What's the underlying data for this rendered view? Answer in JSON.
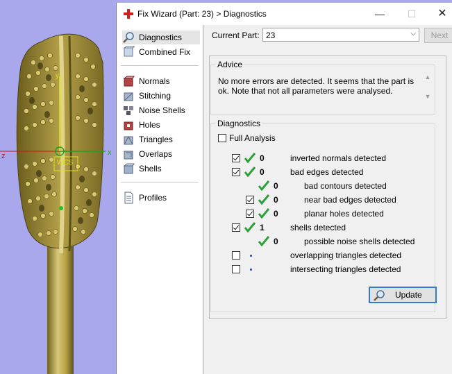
{
  "viewport": {
    "axis_x": "x",
    "axis_y": "y",
    "axis_z": "z",
    "label_box": "WCS"
  },
  "window": {
    "title": "Fix Wizard (Part: 23) > Diagnostics"
  },
  "nav": {
    "items": [
      {
        "label": "Diagnostics",
        "icon": "magnifier-icon"
      },
      {
        "label": "Combined Fix",
        "icon": "combined-fix-icon"
      },
      {
        "label": "Normals",
        "icon": "normals-icon"
      },
      {
        "label": "Stitching",
        "icon": "stitching-icon"
      },
      {
        "label": "Noise Shells",
        "icon": "noise-shells-icon"
      },
      {
        "label": "Holes",
        "icon": "holes-icon"
      },
      {
        "label": "Triangles",
        "icon": "triangles-icon"
      },
      {
        "label": "Overlaps",
        "icon": "overlaps-icon"
      },
      {
        "label": "Shells",
        "icon": "shells-icon"
      },
      {
        "label": "Profiles",
        "icon": "profiles-icon"
      }
    ]
  },
  "current_part": {
    "label": "Current Part:",
    "value": "23"
  },
  "next_label": "Next",
  "advice": {
    "title": "Advice",
    "text": "No more errors are detected. It seems that the part is ok. Note that not all parameters were analysed."
  },
  "diagnostics": {
    "title": "Diagnostics",
    "full_analysis": "Full Analysis",
    "rows": [
      {
        "label": "inverted normals detected",
        "count": "0"
      },
      {
        "label": "bad edges detected",
        "count": "0"
      },
      {
        "label": "bad contours detected",
        "count": "0"
      },
      {
        "label": "near bad edges detected",
        "count": "0"
      },
      {
        "label": "planar holes detected",
        "count": "0"
      },
      {
        "label": "shells detected",
        "count": "1"
      },
      {
        "label": "possible noise shells detected",
        "count": "0"
      },
      {
        "label": "overlapping triangles detected",
        "count": ""
      },
      {
        "label": "intersecting triangles detected",
        "count": ""
      }
    ],
    "update_label": "Update"
  },
  "colors": {
    "accent": "#2f7bd1",
    "check_green": "#2e9e3a",
    "model_gold": "#b8a24a",
    "viewport_bg": "#a9a8ec"
  }
}
